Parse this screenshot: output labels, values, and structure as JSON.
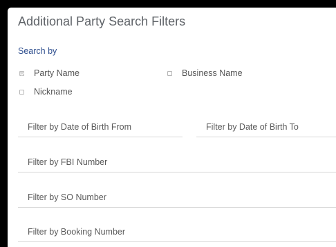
{
  "panel": {
    "title": "Additional Party Search Filters",
    "search_by_label": "Search by"
  },
  "checkboxes": {
    "party_name": {
      "label": "Party Name",
      "checked": true
    },
    "business_name": {
      "label": "Business Name",
      "checked": false
    },
    "nickname": {
      "label": "Nickname",
      "checked": false
    }
  },
  "fields": {
    "dob_from": {
      "placeholder": "Filter by Date of Birth From",
      "value": ""
    },
    "dob_to": {
      "placeholder": "Filter by Date of Birth To",
      "value": ""
    },
    "fbi_number": {
      "placeholder": "Filter by FBI Number",
      "value": ""
    },
    "so_number": {
      "placeholder": "Filter by SO Number",
      "value": ""
    },
    "booking_number": {
      "placeholder": "Filter by Booking Number",
      "value": ""
    }
  }
}
